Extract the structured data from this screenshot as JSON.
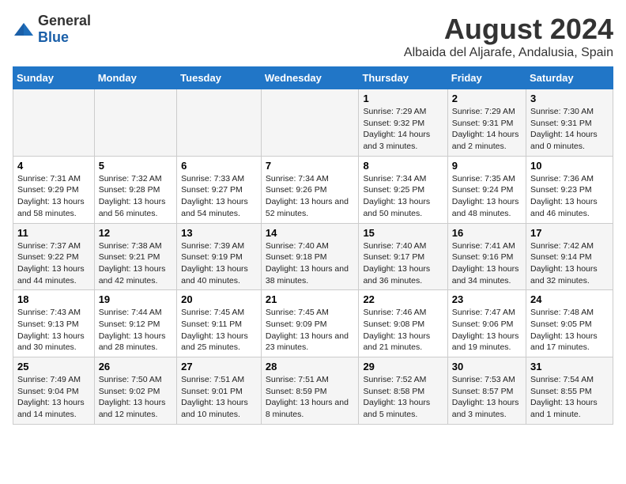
{
  "header": {
    "logo_general": "General",
    "logo_blue": "Blue",
    "title": "August 2024",
    "subtitle": "Albaida del Aljarafe, Andalusia, Spain"
  },
  "days_of_week": [
    "Sunday",
    "Monday",
    "Tuesday",
    "Wednesday",
    "Thursday",
    "Friday",
    "Saturday"
  ],
  "weeks": [
    {
      "days": [
        {
          "number": "",
          "info": ""
        },
        {
          "number": "",
          "info": ""
        },
        {
          "number": "",
          "info": ""
        },
        {
          "number": "",
          "info": ""
        },
        {
          "number": "1",
          "info": "Sunrise: 7:29 AM\nSunset: 9:32 PM\nDaylight: 14 hours\nand 3 minutes."
        },
        {
          "number": "2",
          "info": "Sunrise: 7:29 AM\nSunset: 9:31 PM\nDaylight: 14 hours\nand 2 minutes."
        },
        {
          "number": "3",
          "info": "Sunrise: 7:30 AM\nSunset: 9:31 PM\nDaylight: 14 hours\nand 0 minutes."
        }
      ]
    },
    {
      "days": [
        {
          "number": "4",
          "info": "Sunrise: 7:31 AM\nSunset: 9:29 PM\nDaylight: 13 hours\nand 58 minutes."
        },
        {
          "number": "5",
          "info": "Sunrise: 7:32 AM\nSunset: 9:28 PM\nDaylight: 13 hours\nand 56 minutes."
        },
        {
          "number": "6",
          "info": "Sunrise: 7:33 AM\nSunset: 9:27 PM\nDaylight: 13 hours\nand 54 minutes."
        },
        {
          "number": "7",
          "info": "Sunrise: 7:34 AM\nSunset: 9:26 PM\nDaylight: 13 hours\nand 52 minutes."
        },
        {
          "number": "8",
          "info": "Sunrise: 7:34 AM\nSunset: 9:25 PM\nDaylight: 13 hours\nand 50 minutes."
        },
        {
          "number": "9",
          "info": "Sunrise: 7:35 AM\nSunset: 9:24 PM\nDaylight: 13 hours\nand 48 minutes."
        },
        {
          "number": "10",
          "info": "Sunrise: 7:36 AM\nSunset: 9:23 PM\nDaylight: 13 hours\nand 46 minutes."
        }
      ]
    },
    {
      "days": [
        {
          "number": "11",
          "info": "Sunrise: 7:37 AM\nSunset: 9:22 PM\nDaylight: 13 hours\nand 44 minutes."
        },
        {
          "number": "12",
          "info": "Sunrise: 7:38 AM\nSunset: 9:21 PM\nDaylight: 13 hours\nand 42 minutes."
        },
        {
          "number": "13",
          "info": "Sunrise: 7:39 AM\nSunset: 9:19 PM\nDaylight: 13 hours\nand 40 minutes."
        },
        {
          "number": "14",
          "info": "Sunrise: 7:40 AM\nSunset: 9:18 PM\nDaylight: 13 hours\nand 38 minutes."
        },
        {
          "number": "15",
          "info": "Sunrise: 7:40 AM\nSunset: 9:17 PM\nDaylight: 13 hours\nand 36 minutes."
        },
        {
          "number": "16",
          "info": "Sunrise: 7:41 AM\nSunset: 9:16 PM\nDaylight: 13 hours\nand 34 minutes."
        },
        {
          "number": "17",
          "info": "Sunrise: 7:42 AM\nSunset: 9:14 PM\nDaylight: 13 hours\nand 32 minutes."
        }
      ]
    },
    {
      "days": [
        {
          "number": "18",
          "info": "Sunrise: 7:43 AM\nSunset: 9:13 PM\nDaylight: 13 hours\nand 30 minutes."
        },
        {
          "number": "19",
          "info": "Sunrise: 7:44 AM\nSunset: 9:12 PM\nDaylight: 13 hours\nand 28 minutes."
        },
        {
          "number": "20",
          "info": "Sunrise: 7:45 AM\nSunset: 9:11 PM\nDaylight: 13 hours\nand 25 minutes."
        },
        {
          "number": "21",
          "info": "Sunrise: 7:45 AM\nSunset: 9:09 PM\nDaylight: 13 hours\nand 23 minutes."
        },
        {
          "number": "22",
          "info": "Sunrise: 7:46 AM\nSunset: 9:08 PM\nDaylight: 13 hours\nand 21 minutes."
        },
        {
          "number": "23",
          "info": "Sunrise: 7:47 AM\nSunset: 9:06 PM\nDaylight: 13 hours\nand 19 minutes."
        },
        {
          "number": "24",
          "info": "Sunrise: 7:48 AM\nSunset: 9:05 PM\nDaylight: 13 hours\nand 17 minutes."
        }
      ]
    },
    {
      "days": [
        {
          "number": "25",
          "info": "Sunrise: 7:49 AM\nSunset: 9:04 PM\nDaylight: 13 hours\nand 14 minutes."
        },
        {
          "number": "26",
          "info": "Sunrise: 7:50 AM\nSunset: 9:02 PM\nDaylight: 13 hours\nand 12 minutes."
        },
        {
          "number": "27",
          "info": "Sunrise: 7:51 AM\nSunset: 9:01 PM\nDaylight: 13 hours\nand 10 minutes."
        },
        {
          "number": "28",
          "info": "Sunrise: 7:51 AM\nSunset: 8:59 PM\nDaylight: 13 hours\nand 8 minutes."
        },
        {
          "number": "29",
          "info": "Sunrise: 7:52 AM\nSunset: 8:58 PM\nDaylight: 13 hours\nand 5 minutes."
        },
        {
          "number": "30",
          "info": "Sunrise: 7:53 AM\nSunset: 8:57 PM\nDaylight: 13 hours\nand 3 minutes."
        },
        {
          "number": "31",
          "info": "Sunrise: 7:54 AM\nSunset: 8:55 PM\nDaylight: 13 hours\nand 1 minute."
        }
      ]
    }
  ]
}
